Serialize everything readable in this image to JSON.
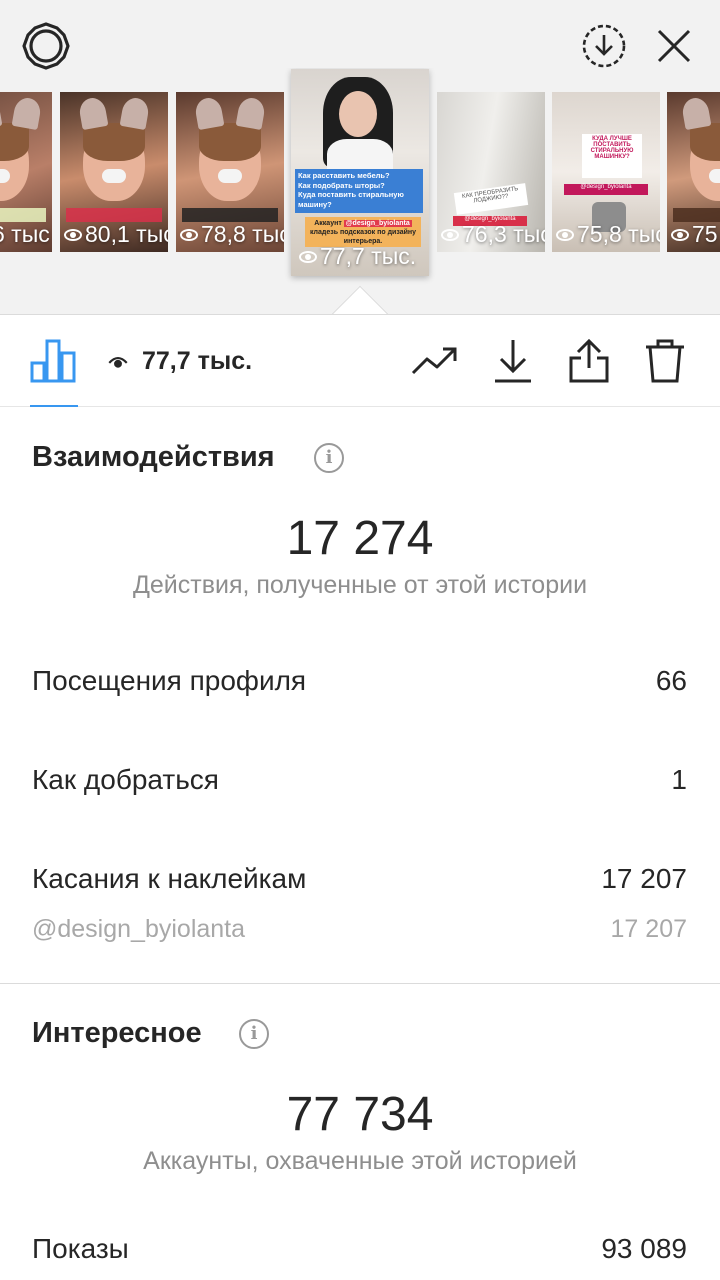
{
  "header": {
    "settings_icon": "gear-icon",
    "download_icon": "download-circle-icon",
    "close_icon": "close-icon"
  },
  "thumbnails": [
    {
      "views": "…6 тыс"
    },
    {
      "views": "80,1 тыс"
    },
    {
      "views": "78,8 тыс"
    },
    {
      "views": "77,7 тыс."
    },
    {
      "views": "76,3 тыс"
    },
    {
      "views": "75,8 тыс"
    },
    {
      "views": "75"
    }
  ],
  "active_story": {
    "lines": [
      "Как расставить мебель?",
      "Как подобрать шторы?",
      "Куда поставить стиральную машину?"
    ],
    "account_line": "Аккаунт",
    "handle": "@design_byiolanta",
    "tagline": "кладезь подсказок по дизайну интерьера."
  },
  "story_texts": {
    "loggia": "КАК ПРЕОБРАЗИТЬ ЛОДЖИЮ??",
    "loggia_handle": "@design_byiolanta",
    "washer": "КУДА ЛУЧШЕ ПОСТАВИТЬ СТИРАЛЬНУЮ МАШИНКУ?",
    "washer_handle": "@design_byiolanta"
  },
  "toolbar": {
    "views": "77,7 тыс."
  },
  "interactions": {
    "title": "Взаимодействия",
    "total": "17 274",
    "caption": "Действия, полученные от этой истории",
    "rows": [
      {
        "label": "Посещения профиля",
        "value": "66"
      },
      {
        "label": "Как добраться",
        "value": "1"
      },
      {
        "label": "Касания к наклейкам",
        "value": "17 207"
      }
    ],
    "sub": {
      "label": "@design_byiolanta",
      "value": "17 207"
    }
  },
  "discovery": {
    "title": "Интересное",
    "total": "77 734",
    "caption": "Аккаунты, охваченные этой историей",
    "rows": [
      {
        "label": "Показы",
        "value": "93 089"
      }
    ]
  },
  "colors": {
    "accent": "#3897f0",
    "text": "#262626",
    "muted": "#8e8e8e"
  }
}
